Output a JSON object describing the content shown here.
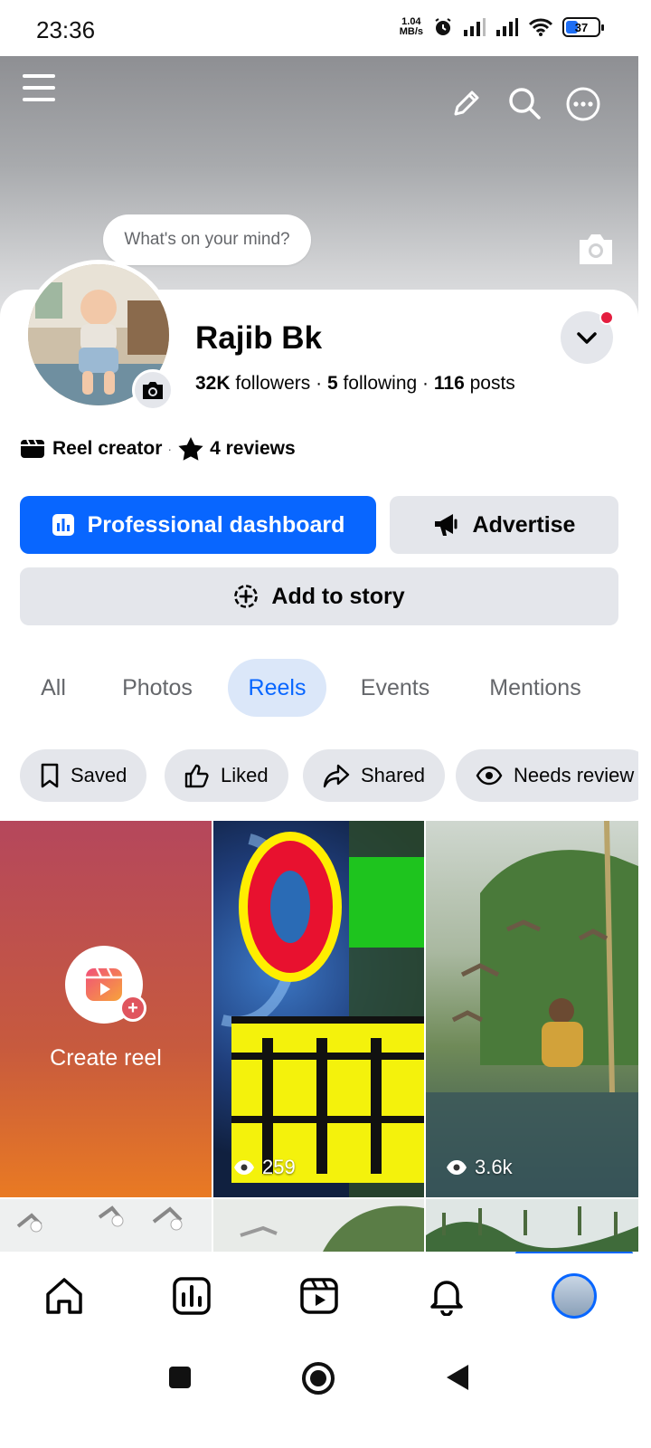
{
  "status_bar": {
    "time": "23:36",
    "net_speed_value": "1.04",
    "net_speed_unit": "MB/s",
    "battery": "37",
    "battery_level": 0.37,
    "icons": [
      "alarm-icon",
      "signal-icon",
      "signal-icon",
      "wifi-icon",
      "battery-icon"
    ]
  },
  "header": {
    "menu_icon": "hamburger-menu-icon",
    "edit_icon": "pencil-icon",
    "search_icon": "search-icon",
    "more_icon": "more-icon"
  },
  "cover": {
    "camera_icon": "camera-icon"
  },
  "mind_bubble": "What's on your mind?",
  "profile": {
    "name": "Rajib Bk",
    "followers_count": "32K",
    "followers_label": "followers",
    "following_count": "5",
    "following_label": "following",
    "posts_count": "116",
    "posts_label": "posts",
    "badge_creator": "Reel creator",
    "badge_reviews": "4 reviews",
    "separator": "·"
  },
  "buttons": {
    "dashboard": "Professional dashboard",
    "advertise": "Advertise",
    "add_story": "Add to story"
  },
  "tabs": [
    "All",
    "Photos",
    "Reels",
    "Events",
    "Mentions"
  ],
  "active_tab": "Reels",
  "chips": [
    "Saved",
    "Liked",
    "Shared",
    "Needs review"
  ],
  "grid": {
    "create_label": "Create reel",
    "reels": [
      {
        "views": "259"
      },
      {
        "views": "3.6k"
      }
    ]
  },
  "colors": {
    "accent": "#0866ff",
    "button_gray": "#e4e6eb",
    "notification_red": "#e41e3f"
  }
}
